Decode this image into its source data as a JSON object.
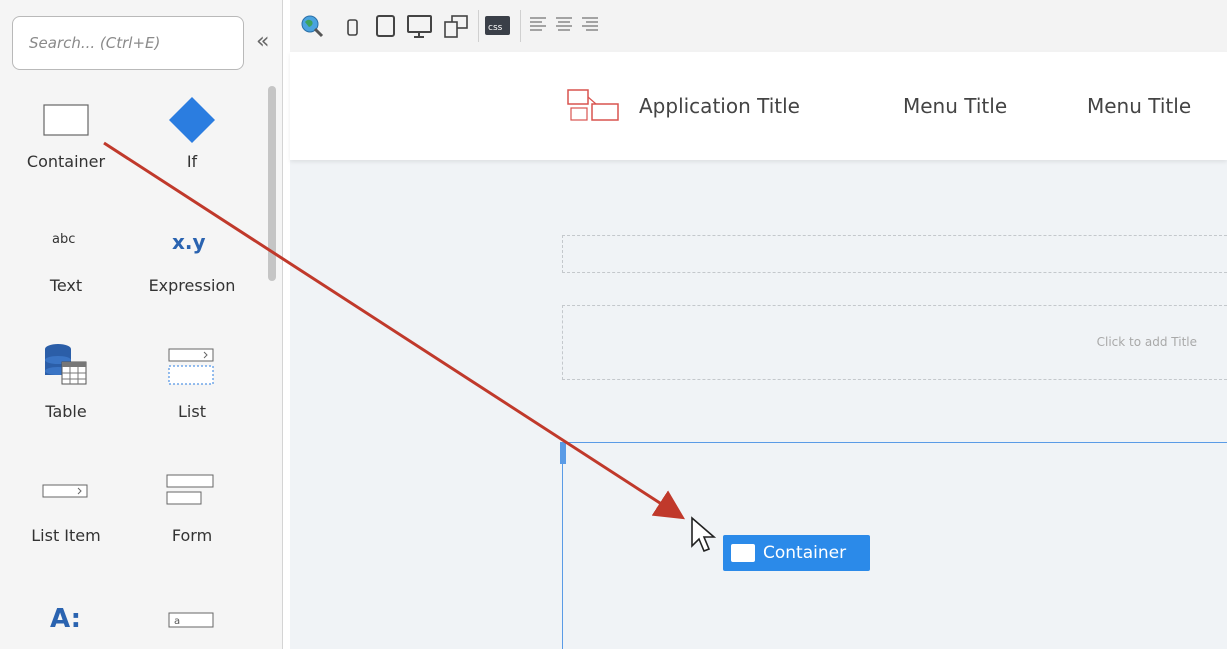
{
  "search": {
    "placeholder": "Search... (Ctrl+E)"
  },
  "sidebar": {
    "collapse_glyph": "«",
    "widgets": [
      {
        "label": "Container",
        "icon": "container-icon"
      },
      {
        "label": "If",
        "icon": "if-diamond-icon"
      },
      {
        "label": "Text",
        "icon": "text-abc-icon",
        "glyph": "abc"
      },
      {
        "label": "Expression",
        "icon": "expression-icon",
        "glyph": "x.y"
      },
      {
        "label": "Table",
        "icon": "table-icon"
      },
      {
        "label": "List",
        "icon": "list-icon"
      },
      {
        "label": "List Item",
        "icon": "list-item-icon"
      },
      {
        "label": "Form",
        "icon": "form-icon"
      },
      {
        "label": "",
        "icon": "label-icon",
        "glyph": "A:"
      },
      {
        "label": "",
        "icon": "input-icon",
        "glyph": "a"
      }
    ]
  },
  "toolbar": {
    "icons": [
      "preview-icon",
      "phone-icon",
      "tablet-icon",
      "desktop-icon",
      "multi-device-icon",
      "css-icon",
      "align-left-icon",
      "align-center-icon",
      "align-right-icon"
    ],
    "css_label": "css"
  },
  "canvas": {
    "header": {
      "app_title": "Application Title",
      "menu_items": [
        "Menu Title",
        "Menu Title"
      ]
    },
    "placeholder_title": "Click to add Title",
    "drag_chip_label": "Container"
  },
  "colors": {
    "accent": "#2b8ae9",
    "drop_border": "#5a9be6",
    "arrow": "#c0392b",
    "icon_blue": "#2a63b0",
    "logo_red": "#d9534f"
  }
}
